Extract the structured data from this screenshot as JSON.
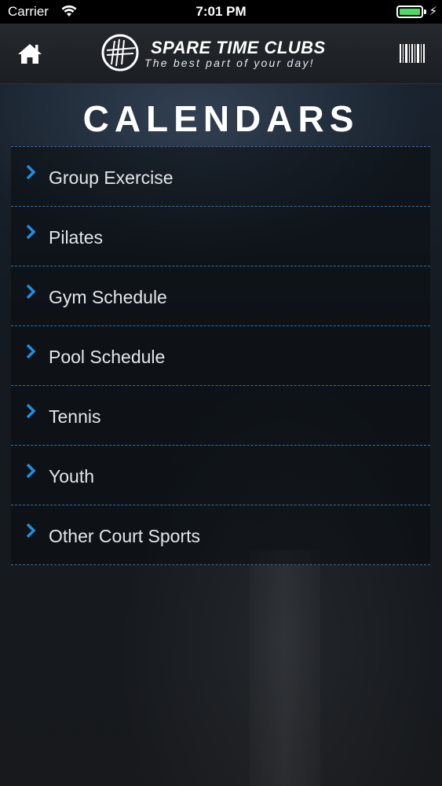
{
  "status_bar": {
    "carrier": "Carrier",
    "time": "7:01 PM"
  },
  "header": {
    "logo_title": "SPARE TIME CLUBS",
    "logo_tagline": "The best part of your day!"
  },
  "page": {
    "title": "CALENDARS"
  },
  "calendar_items": [
    {
      "label": "Group Exercise"
    },
    {
      "label": "Pilates"
    },
    {
      "label": "Gym Schedule"
    },
    {
      "label": "Pool Schedule"
    },
    {
      "label": "Tennis"
    },
    {
      "label": "Youth"
    },
    {
      "label": "Other Court Sports"
    }
  ],
  "colors": {
    "accent": "#1e8fe0",
    "divider": "#2f6fa8",
    "battery": "#4cd964"
  }
}
